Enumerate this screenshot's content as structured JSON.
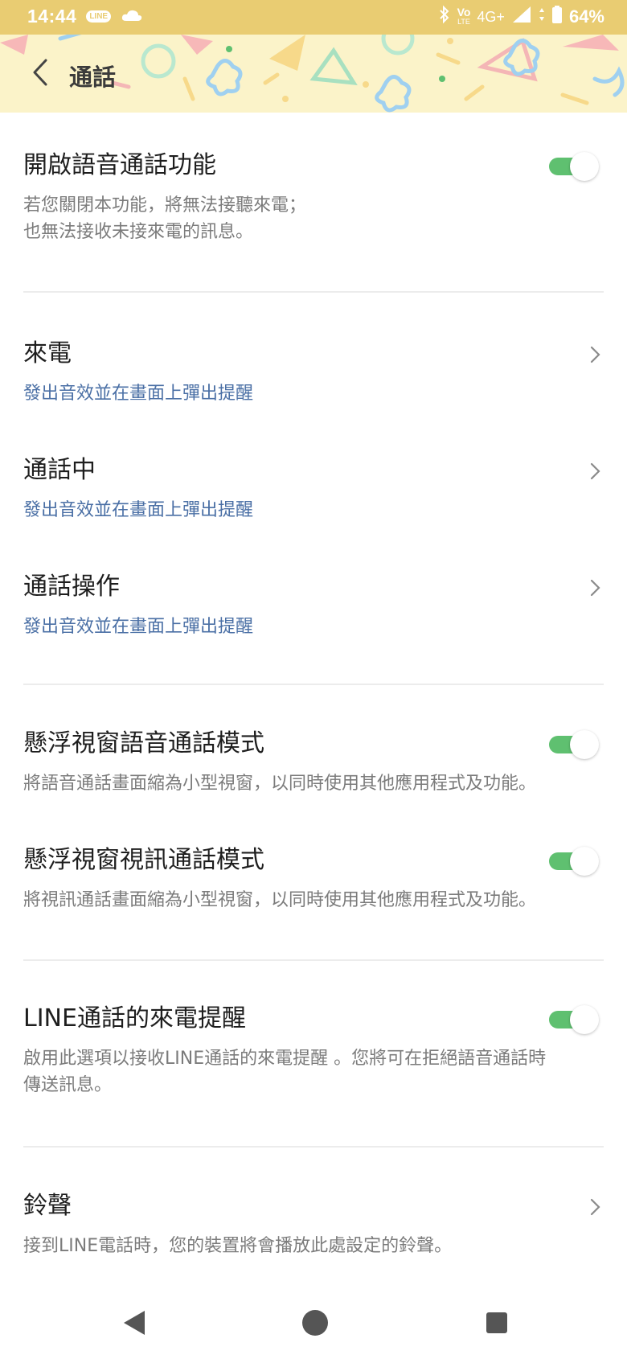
{
  "status_bar": {
    "time": "14:44",
    "line_badge": "LINE",
    "network": "4G+",
    "volte_top": "Vo",
    "volte_bottom": "LTE",
    "battery": "64%"
  },
  "header": {
    "title": "通話"
  },
  "settings": {
    "voice_call": {
      "title": "開啟語音通話功能",
      "desc": "若您關閉本功能，將無法接聽來電；\n也無法接收未接來電的訊息。",
      "enabled": true
    },
    "incoming": {
      "title": "來電",
      "value": "發出音效並在畫面上彈出提醒"
    },
    "in_call": {
      "title": "通話中",
      "value": "發出音效並在畫面上彈出提醒"
    },
    "call_action": {
      "title": "通話操作",
      "value": "發出音效並在畫面上彈出提醒"
    },
    "float_voice": {
      "title": "懸浮視窗語音通話模式",
      "desc": "將語音通話畫面縮為小型視窗，以同時使用其他應用程式及功能。",
      "enabled": true
    },
    "float_video": {
      "title": "懸浮視窗視訊通話模式",
      "desc": "將視訊通話畫面縮為小型視窗，以同時使用其他應用程式及功能。",
      "enabled": true
    },
    "line_reminder": {
      "title": "LINE通話的來電提醒",
      "desc": "啟用此選項以接收LINE通話的來電提醒 。您將可在拒絕語音通話時\n傳送訊息。",
      "enabled": true
    },
    "ringtone": {
      "title": "鈴聲",
      "desc": "接到LINE電話時，您的裝置將會播放此處設定的鈴聲。"
    }
  },
  "colors": {
    "status_bar": "#e9cc72",
    "header_bg": "#fbf3c9",
    "toggle_on": "#5fc070",
    "link_blue": "#4a6fa5"
  }
}
